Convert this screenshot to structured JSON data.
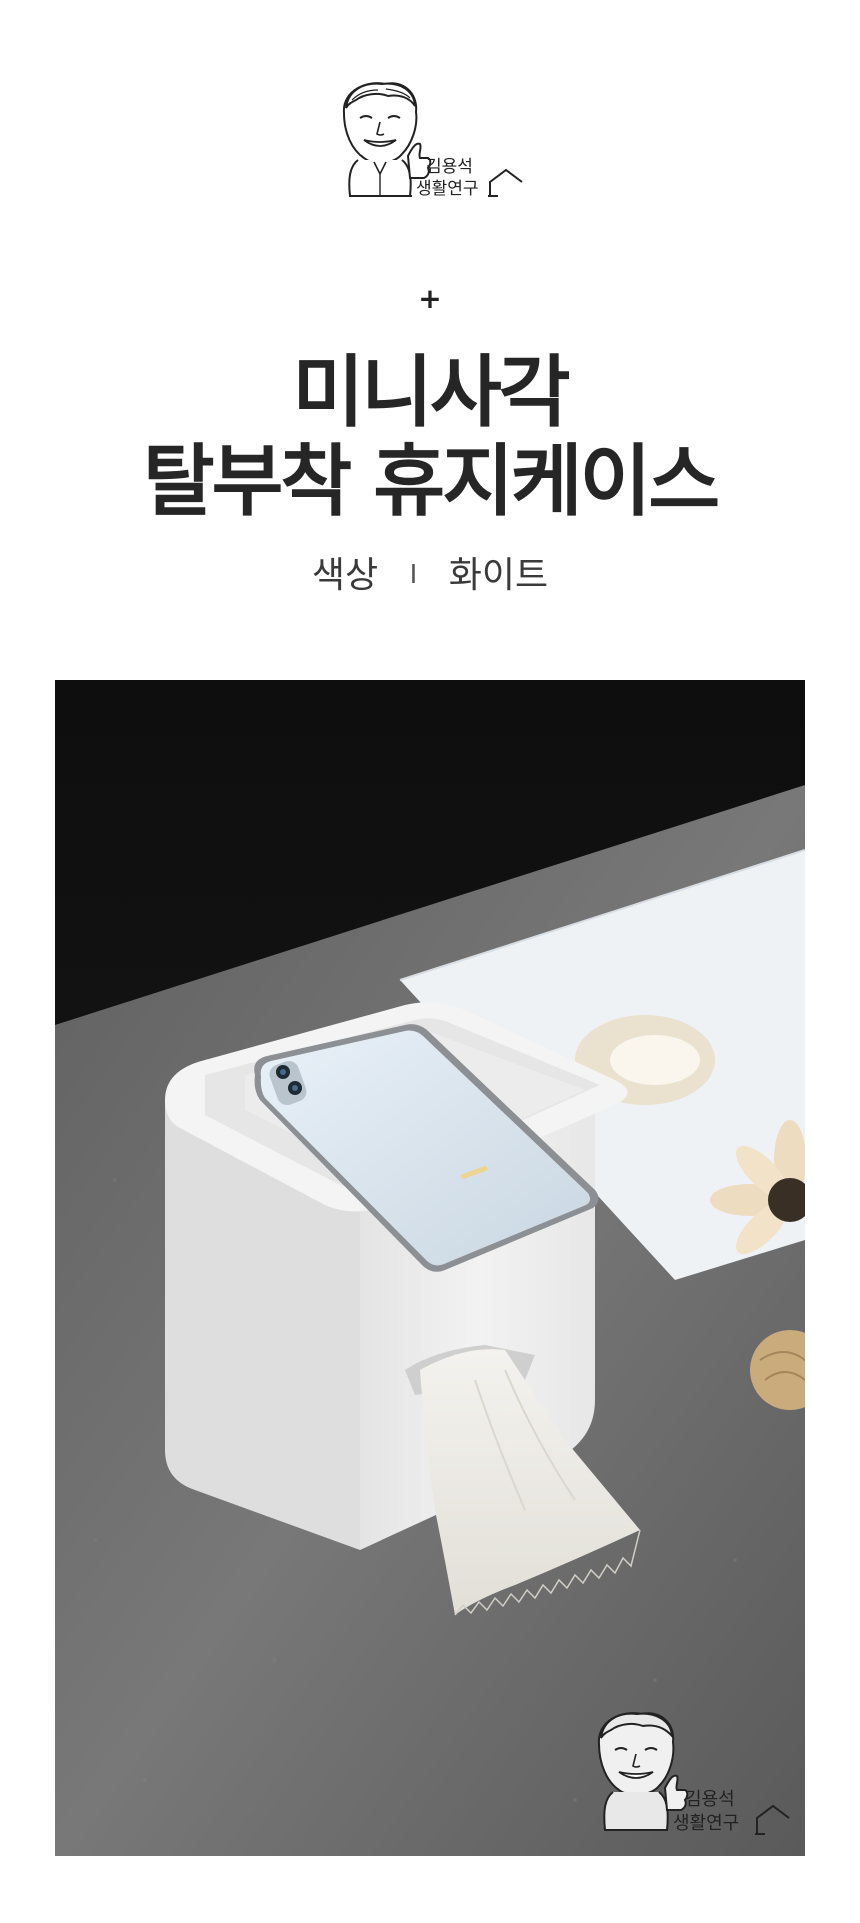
{
  "brand": {
    "line1": "김용석",
    "line2": "생활연구",
    "logo_icon": "caricature-portrait-with-house-icon"
  },
  "header": {
    "decoration": "+",
    "title_line1": "미니사각",
    "title_line2": "탈부착 휴지케이스",
    "color_label": "색상",
    "separator": "I",
    "color_value": "화이트"
  },
  "photo": {
    "subject": "white square tissue case with phone on lid",
    "colors": {
      "background_top": "#151515",
      "table": "#6f6f6f",
      "case": "#f1f1f1"
    }
  }
}
